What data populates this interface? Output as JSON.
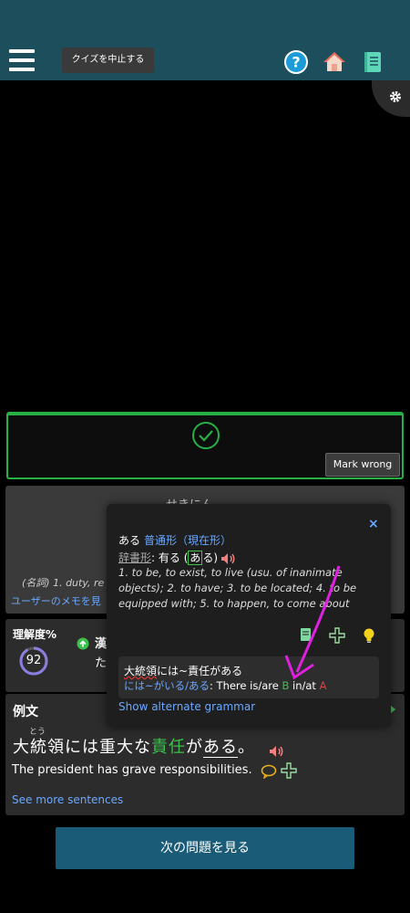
{
  "topbar": {
    "quit_label": "クイズを中止する",
    "icons": [
      "menu-icon",
      "help-icon",
      "home-icon",
      "book-icon"
    ]
  },
  "result": {
    "mark_wrong_label": "Mark wrong"
  },
  "word_card": {
    "reading": "せきにん",
    "definition": "(名詞) 1. duty, re",
    "user_memo": "ユーザーのメモを見"
  },
  "progress_card": {
    "label": "理解度%",
    "score": "92",
    "kanji_label": "漢",
    "kanji_line2": "た"
  },
  "examples_card": {
    "label": "例文",
    "furigana": "とう",
    "sentence_pre": "大統領には重大な",
    "sentence_hl": "責任",
    "sentence_mid": "が",
    "sentence_ul": "ある",
    "sentence_post": "。",
    "translation": "The president has grave responsibilities.",
    "see_more": "See more sentences"
  },
  "next_button": "次の問題を見る",
  "popup": {
    "close": "×",
    "word": "ある",
    "form": "普通形（現在形）",
    "dict_label": "辞書形",
    "dict_sep": ": 有る (",
    "dict_kana": "あ",
    "dict_tail": "る)",
    "definition": "1. to be, to exist, to live (usu. of inanimate objects); 2. to have; 3. to be located; 4. to be equipped with; 5. to happen, to come about",
    "grammar_title_pre": "大統領",
    "grammar_title_post": "には~責任がある",
    "grammar_pattern": "には~がいる/ある",
    "grammar_text_1": ": There is/are ",
    "grammar_b": "B",
    "grammar_text_2": " in/at ",
    "grammar_a": "A",
    "alt_grammar": "Show alternate grammar"
  },
  "colors": {
    "topbar": "#1d4e5c",
    "accent_green": "#3cc14b",
    "link_blue": "#6aa8ff",
    "button_blue": "#1a5c78",
    "annotation_magenta": "#e020e0"
  }
}
